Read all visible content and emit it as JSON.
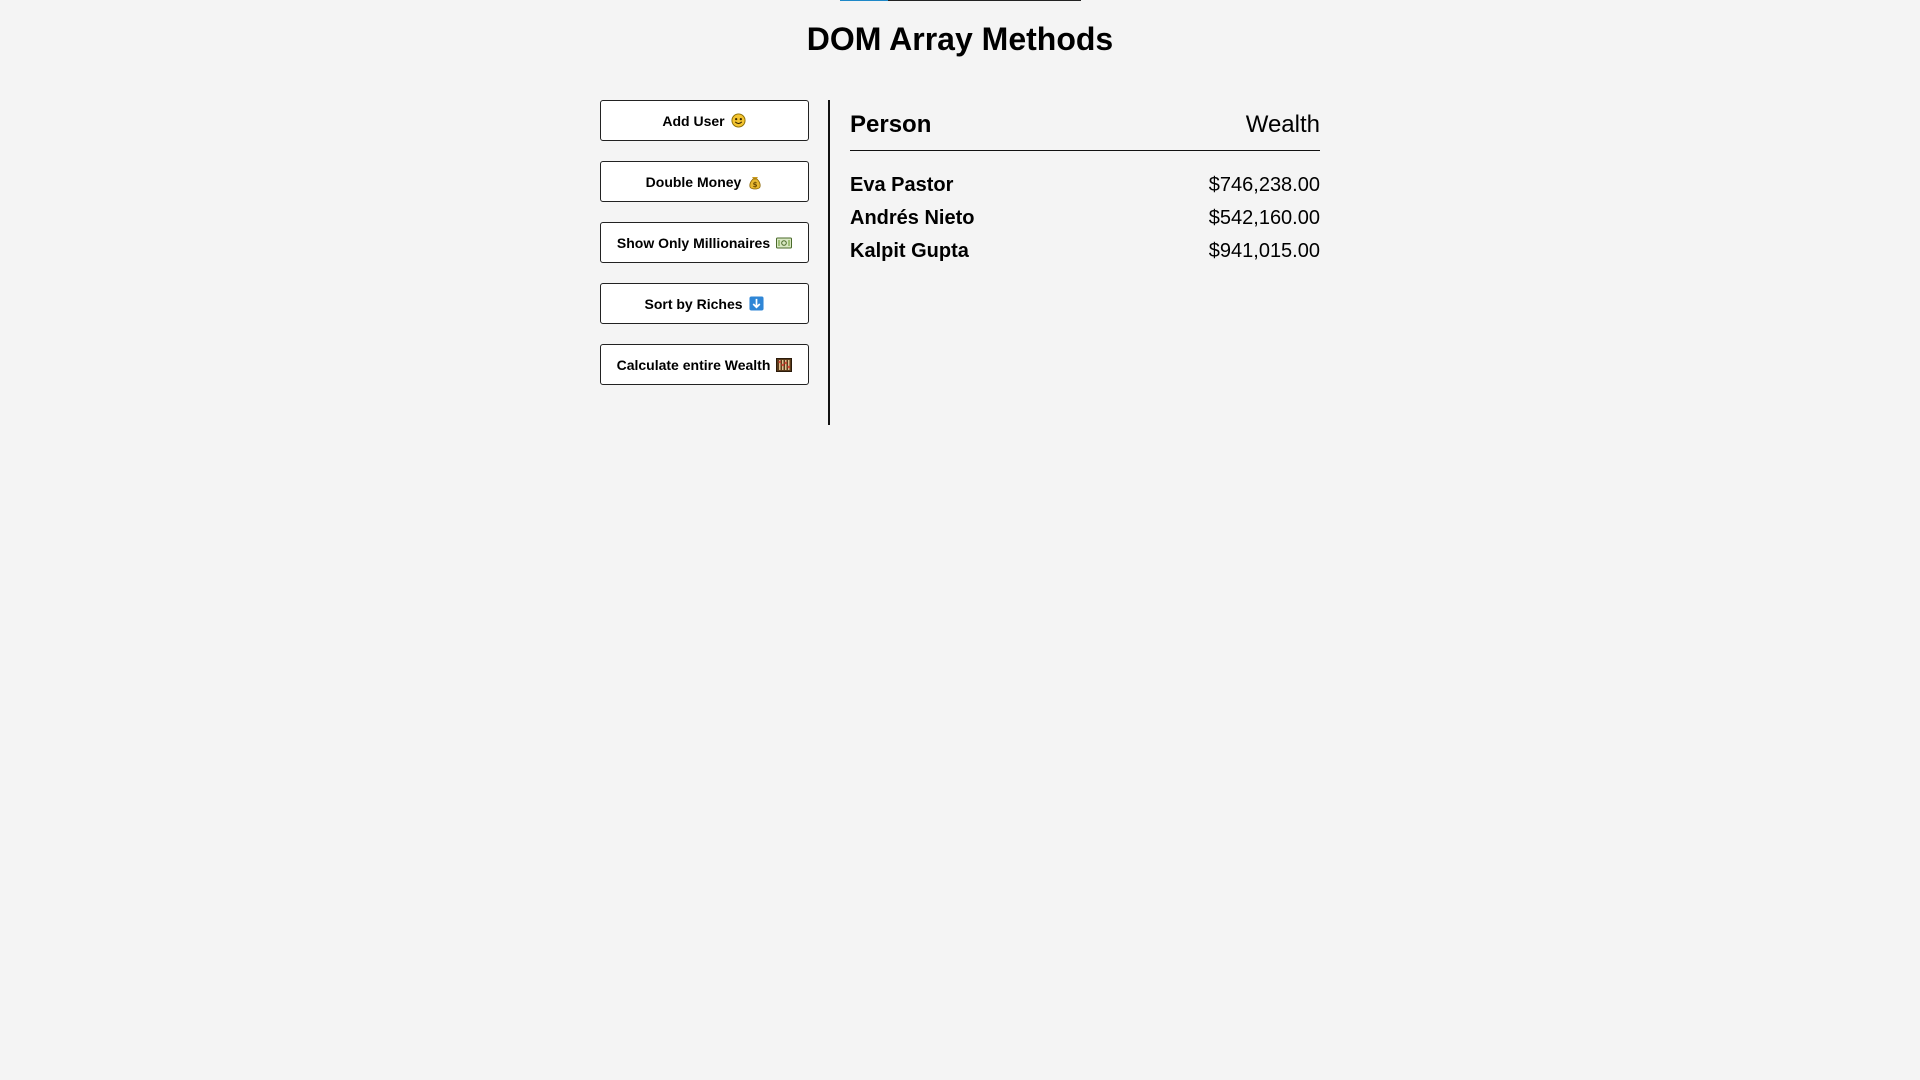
{
  "page": {
    "title": "DOM Array Methods"
  },
  "actions": [
    {
      "label": "Add User",
      "icon": "smiley-money-icon"
    },
    {
      "label": "Double Money",
      "icon": "money-bag-icon"
    },
    {
      "label": "Show Only Millionaires",
      "icon": "banknote-icon"
    },
    {
      "label": "Sort by Riches",
      "icon": "sort-icon"
    },
    {
      "label": "Calculate entire Wealth",
      "icon": "abacus-icon"
    }
  ],
  "table": {
    "header": {
      "person": "Person",
      "wealth": "Wealth"
    },
    "rows": [
      {
        "name": "Eva Pastor",
        "wealth": "$746,238.00"
      },
      {
        "name": "Andrés Nieto",
        "wealth": "$542,160.00"
      },
      {
        "name": "Kalpit Gupta",
        "wealth": "$941,015.00"
      }
    ]
  },
  "colors": {
    "background": "#f4f4f4",
    "accent": "#1e88c8"
  }
}
